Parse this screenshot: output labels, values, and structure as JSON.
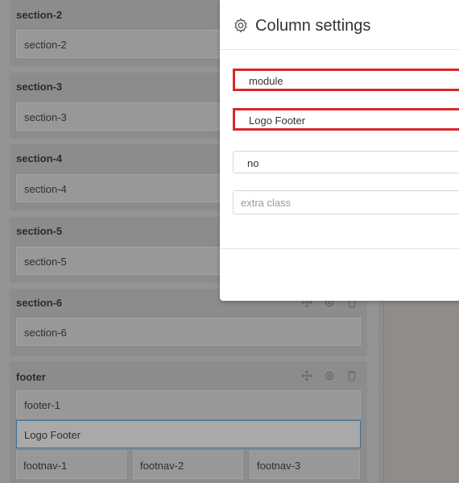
{
  "sections": [
    {
      "title": "section-2",
      "content": "section-2"
    },
    {
      "title": "section-3",
      "content": "section-3"
    },
    {
      "title": "section-4",
      "content": "section-4"
    },
    {
      "title": "section-5",
      "content": "section-5"
    },
    {
      "title": "section-6",
      "content": "section-6"
    }
  ],
  "footer": {
    "title": "footer",
    "rows": [
      "footer-1",
      "Logo Footer"
    ],
    "nav": [
      "footnav-1",
      "footnav-2",
      "footnav-3"
    ]
  },
  "modal": {
    "title": "Column settings",
    "type_value": "module",
    "module_value": "Logo Footer",
    "option_value": "no",
    "class_placeholder": "extra class"
  },
  "icons": [
    "move-icon",
    "gear-icon",
    "trash-icon"
  ]
}
